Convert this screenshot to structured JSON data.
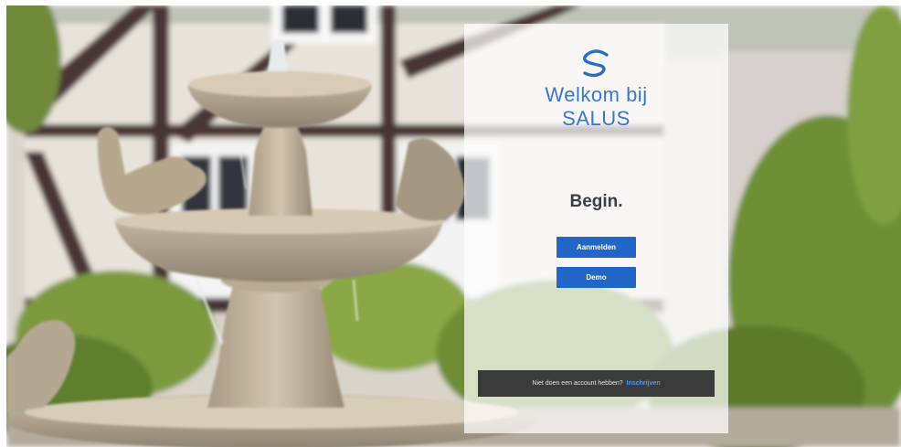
{
  "brand": {
    "welcome_line1": "Welkom bij",
    "welcome_line2": "SALUS",
    "logo_icon": "salus-s-logo-icon",
    "accent_color": "#3a78c4"
  },
  "main": {
    "heading": "Begin."
  },
  "actions": {
    "login_label": "Aanmelden",
    "demo_label": "Demo",
    "button_color": "#2266c8"
  },
  "signup": {
    "prompt": "Niet doen een account hebben?",
    "link_label": "Inschrijven",
    "bar_color": "#3b3b3b"
  },
  "background": {
    "subject": "fountain-with-birds-and-half-timbered-house"
  }
}
